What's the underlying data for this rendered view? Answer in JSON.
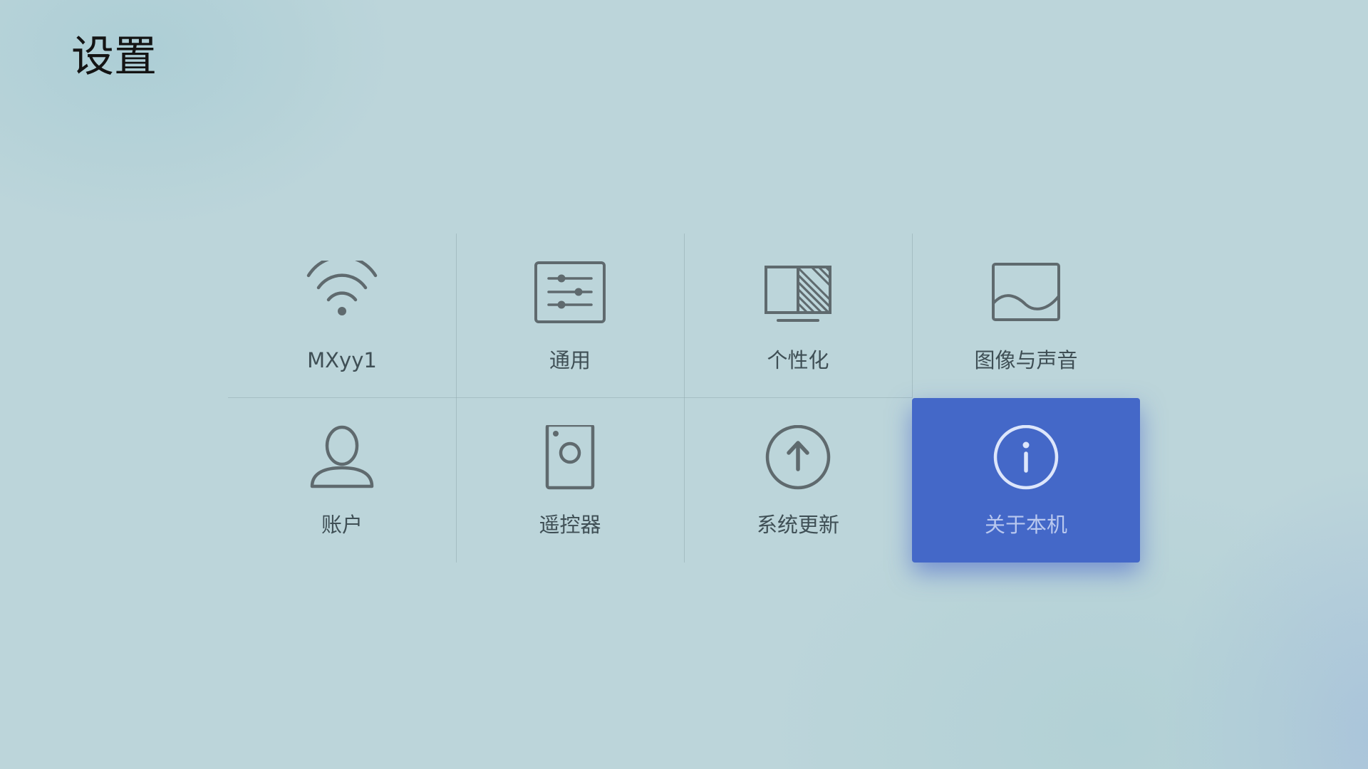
{
  "header": {
    "title": "设置"
  },
  "tiles": [
    {
      "label": "MXyy1",
      "icon": "wifi-icon"
    },
    {
      "label": "通用",
      "icon": "sliders-icon"
    },
    {
      "label": "个性化",
      "icon": "display-theme-icon"
    },
    {
      "label": "图像与声音",
      "icon": "picture-icon"
    },
    {
      "label": "账户",
      "icon": "user-icon"
    },
    {
      "label": "遥控器",
      "icon": "remote-icon"
    },
    {
      "label": "系统更新",
      "icon": "update-arrow-icon"
    },
    {
      "label": "关于本机",
      "icon": "info-icon",
      "focused": true
    }
  ],
  "colors": {
    "background": "#bcd5da",
    "icon_stroke": "#5f6a6e",
    "label": "#3f4f55",
    "focus_background": "#4468c8",
    "focus_label": "#b9c8ef"
  }
}
